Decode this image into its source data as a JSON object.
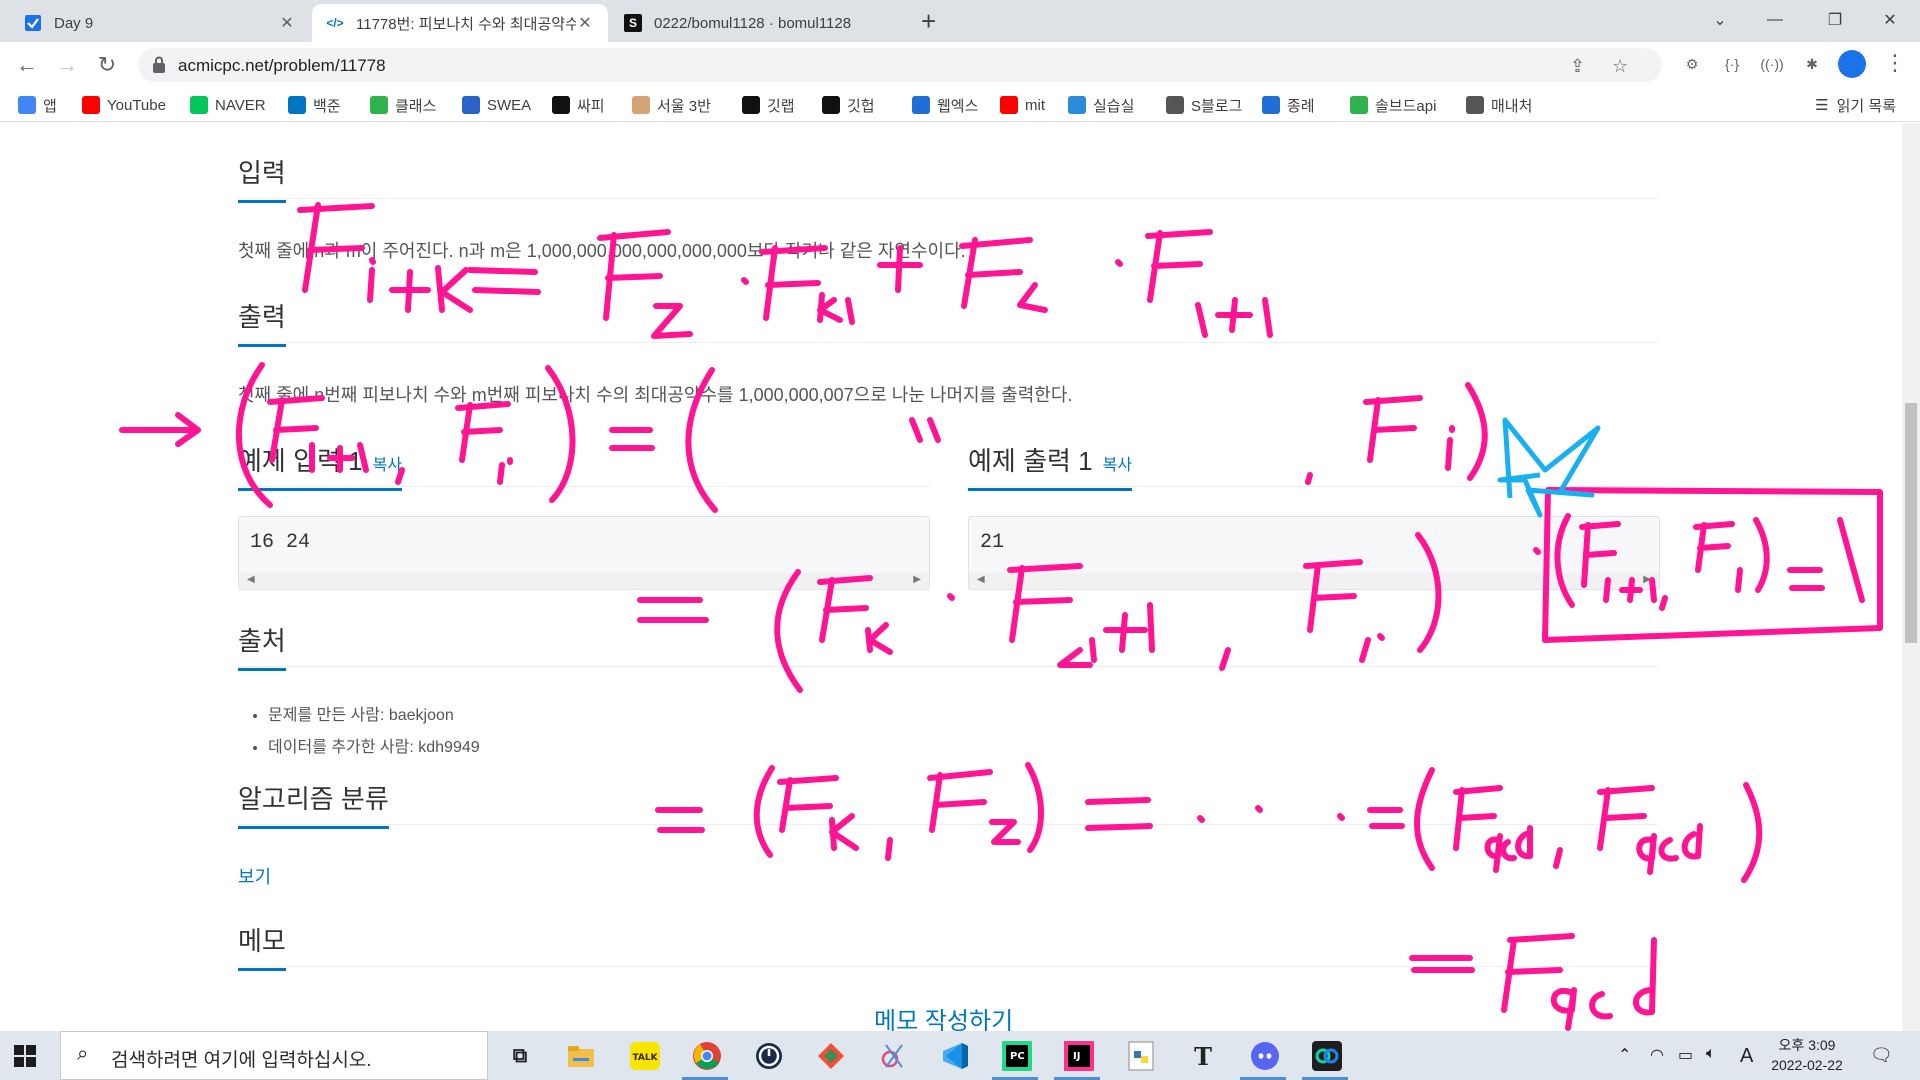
{
  "browser": {
    "tabs": [
      {
        "title": "Day 9",
        "active": false
      },
      {
        "title": "11778번: 피보나치 수와 최대공약수",
        "active": true
      },
      {
        "title": "0222/bomul1128 · bomul1128",
        "active": false
      }
    ],
    "url": "acmicpc.net/problem/11778",
    "bookmarks": [
      {
        "label": "앱",
        "icon": "apps-grid-icon",
        "color": "#4285f4"
      },
      {
        "label": "YouTube",
        "icon": "youtube-icon",
        "color": "#ff0000"
      },
      {
        "label": "NAVER",
        "icon": "naver-icon",
        "color": "#03c75a"
      },
      {
        "label": "백준",
        "icon": "baekjoon-icon",
        "color": "#0076c0"
      },
      {
        "label": "클래스",
        "icon": "class-icon",
        "color": "#2fb24c"
      },
      {
        "label": "SWEA",
        "icon": "swea-icon",
        "color": "#2b62c6"
      },
      {
        "label": "싸피",
        "icon": "ssafy-icon",
        "color": "#111111"
      },
      {
        "label": "서울 3반",
        "icon": "bandage-icon",
        "color": "#d4a373"
      },
      {
        "label": "깃랩",
        "icon": "gitlab-icon",
        "color": "#111111"
      },
      {
        "label": "깃헙",
        "icon": "github-icon",
        "color": "#111111"
      },
      {
        "label": "웹엑스",
        "icon": "webex-icon",
        "color": "#1f6fd6"
      },
      {
        "label": "mit",
        "icon": "youtube-icon",
        "color": "#ff0000"
      },
      {
        "label": "실습실",
        "icon": "lab-icon",
        "color": "#2a8bd8"
      },
      {
        "label": "S블로그",
        "icon": "blog-icon",
        "color": "#555555"
      },
      {
        "label": "종례",
        "icon": "webex-icon",
        "color": "#1f6fd6"
      },
      {
        "label": "솔브드api",
        "icon": "solvedac-icon",
        "color": "#2fb24c"
      },
      {
        "label": "매내처",
        "icon": "globe-icon",
        "color": "#555555"
      }
    ],
    "reading_list": "읽기 목록"
  },
  "page": {
    "input_heading": "입력",
    "input_text": "첫째 줄에 n과 m이 주어진다. n과 m은 1,000,000,000,000,000,000보다 작거나 같은 자연수이다.",
    "output_heading": "출력",
    "output_text": "첫째 줄에 n번째 피보나치 수와 m번째 피보나치 수의 최대공약수를 1,000,000,007으로 나눈 나머지를 출력한다.",
    "sample_input_heading": "예제 입력 1",
    "sample_output_heading": "예제 출력 1",
    "copy_label": "복사",
    "sample_input": "16 24",
    "sample_output": "21",
    "source_heading": "출처",
    "credits": [
      "문제를 만든 사람: baekjoon",
      "데이터를 추가한 사람: kdh9949"
    ],
    "algo_heading": "알고리즘 분류",
    "algo_view": "보기",
    "memo_heading": "메모",
    "memo_write": "메모 작성하기"
  },
  "taskbar": {
    "search_placeholder": "검색하려면 여기에 입력하십시오.",
    "ampm_time": "오후 3:09",
    "date": "2022-02-22",
    "ime": "A"
  },
  "colors": {
    "accent": "#0076c0",
    "ink_pink": "#ff1493",
    "ink_cyan": "#1ab0f0"
  }
}
